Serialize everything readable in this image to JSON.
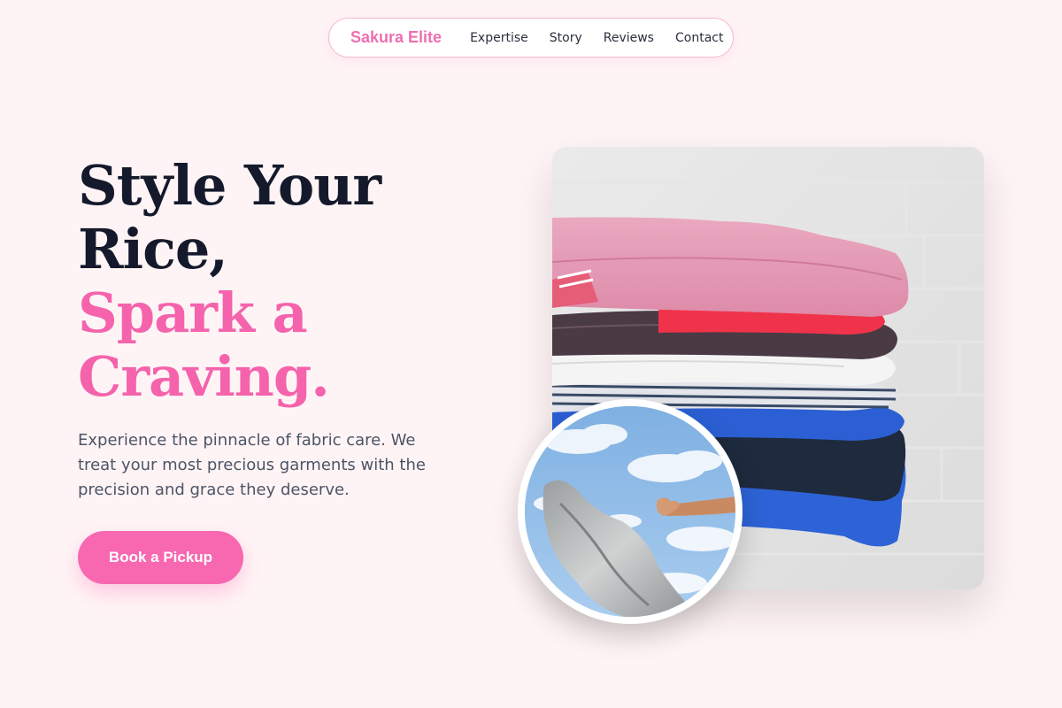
{
  "nav": {
    "brand": "Sakura Elite",
    "links": [
      "Expertise",
      "Story",
      "Reviews",
      "Contact"
    ]
  },
  "hero": {
    "headline_line1": "Style Your",
    "headline_line2": "Rice,",
    "headline_line3": "Spark a",
    "headline_line4": "Craving.",
    "lead": "Experience the pinnacle of fabric care. We treat your most precious garments with the precision and grace they deserve.",
    "cta_label": "Book a Pickup"
  },
  "colors": {
    "accent": "#f463ac",
    "background": "#fff4f5",
    "headline_dark": "#141a2b"
  }
}
